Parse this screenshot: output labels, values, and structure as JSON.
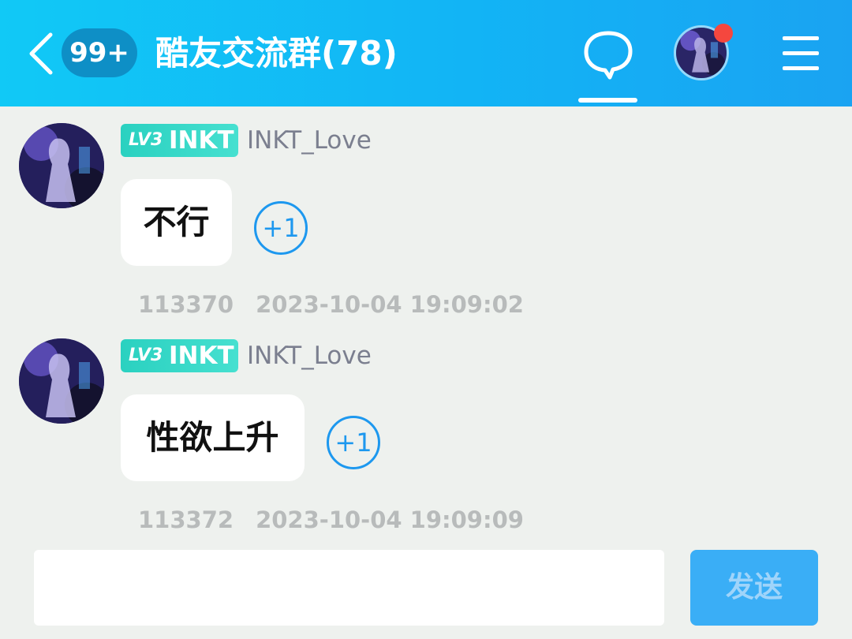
{
  "header": {
    "unread_badge": "99+",
    "title": "酷友交流群(78)",
    "colors": {
      "gradient_start": "#11c9f6",
      "gradient_end": "#1aa3f2",
      "notification": "#f5473e"
    }
  },
  "messages": [
    {
      "level": "LV3",
      "level_name": "INKT",
      "username": "INKT_Love",
      "text": "不行",
      "plus_one": "+1",
      "id": "113370",
      "timestamp": "2023-10-04 19:09:02"
    },
    {
      "level": "LV3",
      "level_name": "INKT",
      "username": "INKT_Love",
      "text": "性欲上升",
      "plus_one": "+1",
      "id": "113372",
      "timestamp": "2023-10-04 19:09:09"
    }
  ],
  "composer": {
    "input_value": "",
    "send_label": "发送",
    "send_color": "#3aaef6"
  }
}
